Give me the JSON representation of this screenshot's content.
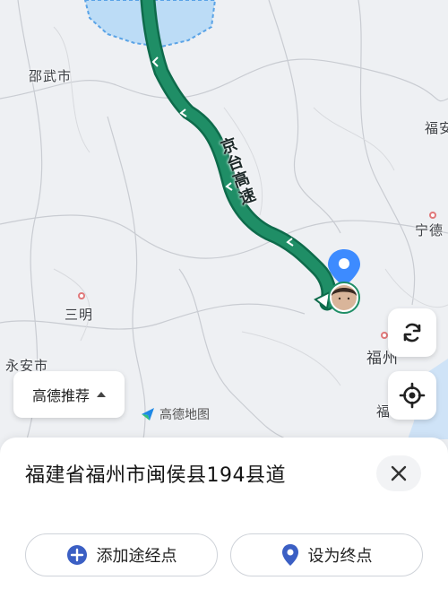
{
  "map": {
    "places": {
      "shaowu": "邵武市",
      "sanming": "三明",
      "yongan": "永安市",
      "fuzhou": "福州",
      "ningde": "宁德",
      "edge_top": "福安",
      "edge_bottom": "福"
    },
    "highway_label": "京台高速",
    "colors": {
      "route": "#1f8e66",
      "route_outline": "#0e6b4b",
      "water": "#bcdcf6",
      "pin": "#3d8bff"
    }
  },
  "controls": {
    "route_pref_label": "高德推荐",
    "refresh_icon": "refresh-icon",
    "locate_icon": "locate-icon"
  },
  "brand": {
    "name": "高德地图"
  },
  "sheet": {
    "address": "福建省福州市闽侯县194县道",
    "add_waypoint_label": "添加途经点",
    "set_destination_label": "设为终点"
  }
}
